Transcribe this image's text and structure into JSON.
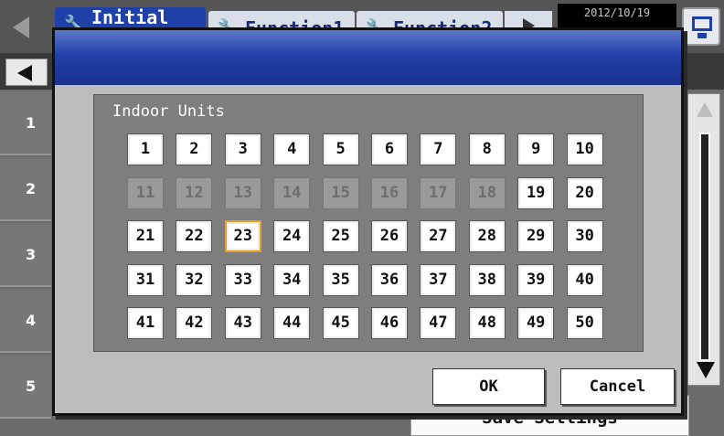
{
  "topbar": {
    "tabs": [
      {
        "label": "Initial",
        "active": true
      },
      {
        "label": "Function1",
        "active": false
      },
      {
        "label": "Function2",
        "active": false
      }
    ],
    "datetime": "2012/10/19"
  },
  "side_rows": [
    "1",
    "2",
    "3",
    "4",
    "5"
  ],
  "save_settings_label": "Save Settings",
  "dialog": {
    "title": "Indoor Units",
    "units": [
      {
        "label": "1",
        "state": "enabled"
      },
      {
        "label": "2",
        "state": "enabled"
      },
      {
        "label": "3",
        "state": "enabled"
      },
      {
        "label": "4",
        "state": "enabled"
      },
      {
        "label": "5",
        "state": "enabled"
      },
      {
        "label": "6",
        "state": "enabled"
      },
      {
        "label": "7",
        "state": "enabled"
      },
      {
        "label": "8",
        "state": "enabled"
      },
      {
        "label": "9",
        "state": "enabled"
      },
      {
        "label": "10",
        "state": "enabled"
      },
      {
        "label": "11",
        "state": "disabled"
      },
      {
        "label": "12",
        "state": "disabled"
      },
      {
        "label": "13",
        "state": "disabled"
      },
      {
        "label": "14",
        "state": "disabled"
      },
      {
        "label": "15",
        "state": "disabled"
      },
      {
        "label": "16",
        "state": "disabled"
      },
      {
        "label": "17",
        "state": "disabled"
      },
      {
        "label": "18",
        "state": "disabled"
      },
      {
        "label": "19",
        "state": "enabled"
      },
      {
        "label": "20",
        "state": "enabled"
      },
      {
        "label": "21",
        "state": "enabled"
      },
      {
        "label": "22",
        "state": "enabled"
      },
      {
        "label": "23",
        "state": "selected"
      },
      {
        "label": "24",
        "state": "enabled"
      },
      {
        "label": "25",
        "state": "enabled"
      },
      {
        "label": "26",
        "state": "enabled"
      },
      {
        "label": "27",
        "state": "enabled"
      },
      {
        "label": "28",
        "state": "enabled"
      },
      {
        "label": "29",
        "state": "enabled"
      },
      {
        "label": "30",
        "state": "enabled"
      },
      {
        "label": "31",
        "state": "enabled"
      },
      {
        "label": "32",
        "state": "enabled"
      },
      {
        "label": "33",
        "state": "enabled"
      },
      {
        "label": "34",
        "state": "enabled"
      },
      {
        "label": "35",
        "state": "enabled"
      },
      {
        "label": "36",
        "state": "enabled"
      },
      {
        "label": "37",
        "state": "enabled"
      },
      {
        "label": "38",
        "state": "enabled"
      },
      {
        "label": "39",
        "state": "enabled"
      },
      {
        "label": "40",
        "state": "enabled"
      },
      {
        "label": "41",
        "state": "enabled"
      },
      {
        "label": "42",
        "state": "enabled"
      },
      {
        "label": "43",
        "state": "enabled"
      },
      {
        "label": "44",
        "state": "enabled"
      },
      {
        "label": "45",
        "state": "enabled"
      },
      {
        "label": "46",
        "state": "enabled"
      },
      {
        "label": "47",
        "state": "enabled"
      },
      {
        "label": "48",
        "state": "enabled"
      },
      {
        "label": "49",
        "state": "enabled"
      },
      {
        "label": "50",
        "state": "enabled"
      }
    ],
    "ok_label": "OK",
    "cancel_label": "Cancel"
  },
  "colors": {
    "header_blue": "#2240a8",
    "selected_outline": "#e89d2a",
    "disabled_unit": "#9a9a9a"
  },
  "icons": [
    "wrench-icon",
    "monitor-icon",
    "back-arrow-icon",
    "scroll-up-icon",
    "scroll-down-icon",
    "next-tab-icon",
    "prev-nav-icon"
  ]
}
